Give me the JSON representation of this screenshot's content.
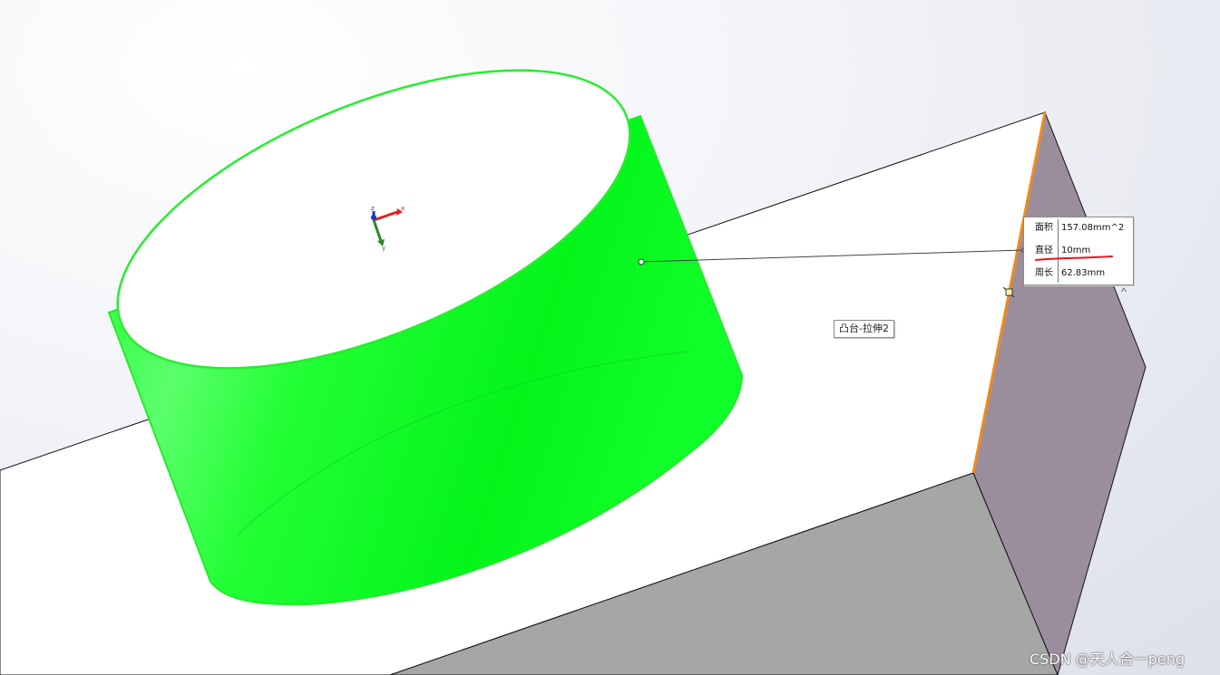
{
  "measure": {
    "area_label": "面积",
    "area_value": "157.08mm^2",
    "diameter_label": "直径",
    "diameter_value": "10mm",
    "perimeter_label": "周长",
    "perimeter_value": "62.83mm"
  },
  "feature_tag": "凸台-拉伸2",
  "triad": {
    "x": "x",
    "y": "y",
    "z": "z"
  },
  "watermark": "CSDN @天人合一peng",
  "icons": {
    "expand": "chevron-up-icon",
    "vertex_marker": "square-vertex-marker-icon"
  },
  "colors": {
    "selected_face": "#00ff1e",
    "selected_edge": "#f08a1c",
    "side_face": "#9b8e9c",
    "front_face": "#a6a6a6",
    "annotation_underline": "#e8141e"
  }
}
